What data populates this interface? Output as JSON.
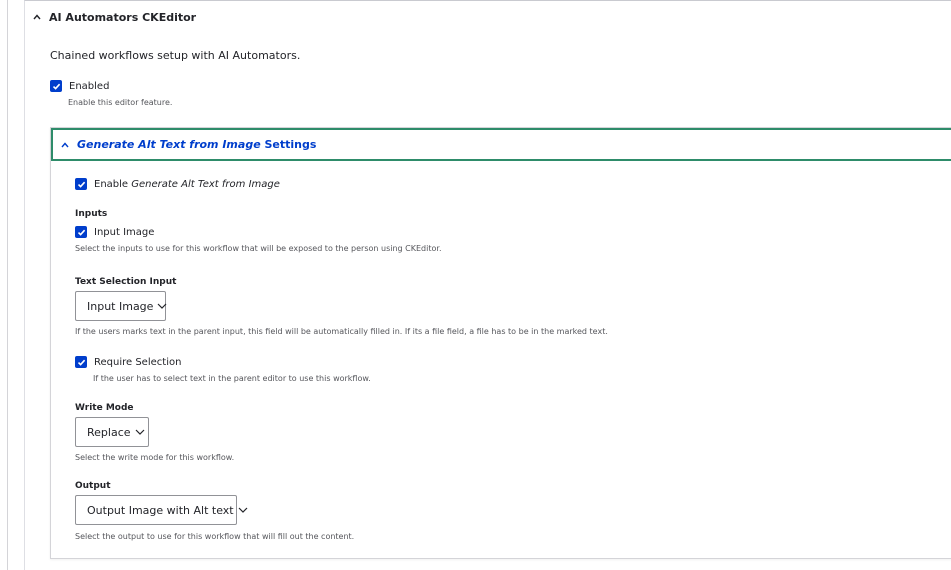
{
  "section": {
    "title": "AI Automators CKEditor",
    "description": "Chained workflows setup with AI Automators.",
    "enabled_label": "Enabled",
    "enabled_checked": true,
    "enabled_help": "Enable this editor feature."
  },
  "workflow": {
    "title_em": "Generate Alt Text from Image",
    "title_suffix": " Settings",
    "enable_prefix": "Enable ",
    "enable_em": "Generate Alt Text from Image",
    "enable_checked": true,
    "inputs": {
      "label": "Inputs",
      "option_label": "Input Image",
      "option_checked": true,
      "help": "Select the inputs to use for this workflow that will be exposed to the person using CKEditor."
    },
    "text_selection": {
      "label": "Text Selection Input",
      "value": "Input Image",
      "help": "If the users marks text in the parent input, this field will be automatically filled in. If its a file field, a file has to be in the marked text."
    },
    "require_selection": {
      "label": "Require Selection",
      "checked": true,
      "help": "If the user has to select text in the parent editor to use this workflow."
    },
    "write_mode": {
      "label": "Write Mode",
      "value": "Replace",
      "help": "Select the write mode for this workflow."
    },
    "output": {
      "label": "Output",
      "value": "Output Image with Alt text",
      "help": "Select the output to use for this workflow that will fill out the content."
    }
  },
  "colors": {
    "accent": "#003ecc",
    "focus_border": "#2e8c6a"
  }
}
